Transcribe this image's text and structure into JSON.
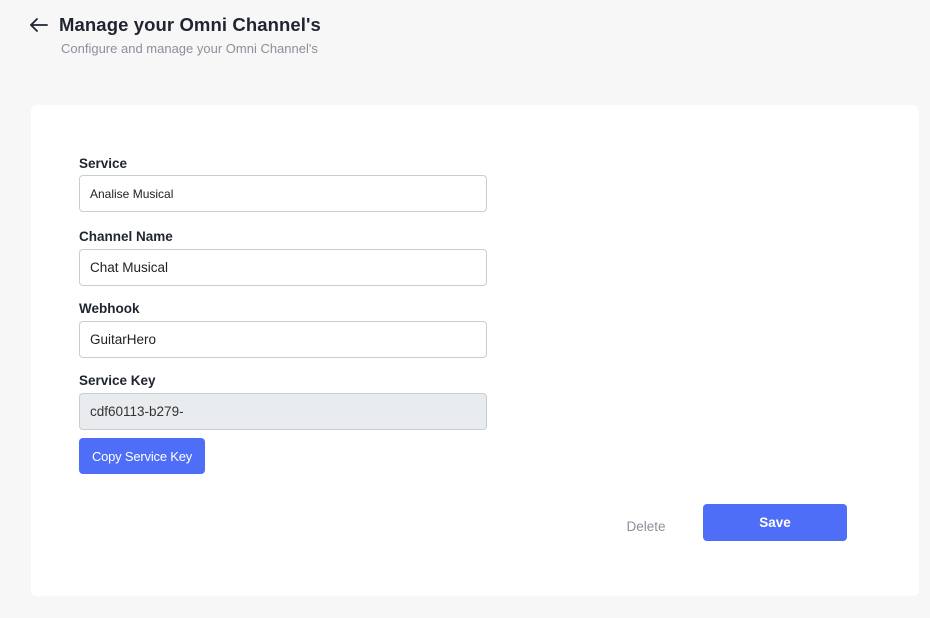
{
  "header": {
    "back_icon": "arrow-left-icon",
    "title": "Manage your Omni Channel's",
    "subtitle": "Configure and manage your Omni Channel's"
  },
  "form": {
    "service": {
      "label": "Service",
      "value": "Analise Musical"
    },
    "channel_name": {
      "label": "Channel Name",
      "value": "Chat Musical"
    },
    "webhook": {
      "label": "Webhook",
      "value": "GuitarHero"
    },
    "service_key": {
      "label": "Service Key",
      "value": "cdf60113-b279-"
    },
    "copy_button": "Copy Service Key"
  },
  "actions": {
    "delete_label": "Delete",
    "save_label": "Save"
  },
  "colors": {
    "accent": "#4f6ef7",
    "page_background": "#f7f7f8",
    "card_background": "#ffffff",
    "readonly_background": "#e9ecef"
  }
}
